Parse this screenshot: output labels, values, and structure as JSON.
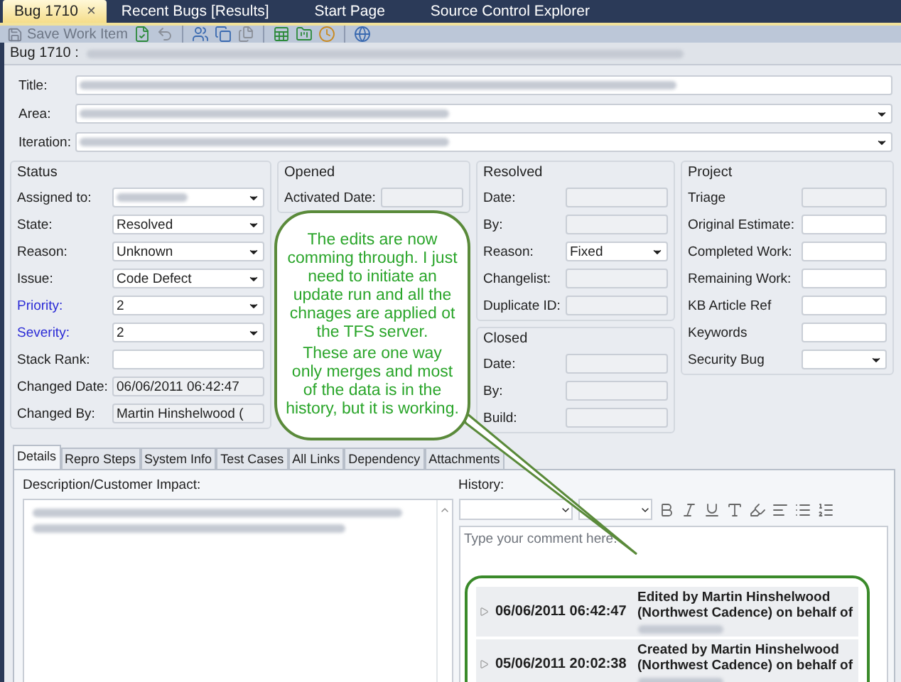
{
  "tabs": [
    {
      "label": "Bug 1710",
      "selected": true,
      "close": "×"
    },
    {
      "label": "Recent Bugs [Results]",
      "selected": false
    },
    {
      "label": "Start Page",
      "selected": false
    },
    {
      "label": "Source Control Explorer",
      "selected": false
    }
  ],
  "toolbar": {
    "save": {
      "label": "Save Work Item",
      "disabled": true
    }
  },
  "header": {
    "label": "Bug 1710 :"
  },
  "top_fields": [
    {
      "label": "Title:",
      "kind": "text"
    },
    {
      "label": "Area:",
      "kind": "dropdown"
    },
    {
      "label": "Iteration:",
      "kind": "dropdown"
    }
  ],
  "columns": [
    {
      "groups": [
        {
          "title": "Status",
          "fields": [
            {
              "label": "Assigned to:",
              "kind": "dropdown",
              "redacted": true,
              "required": false
            },
            {
              "label": "State:",
              "kind": "dropdown",
              "value": "Resolved",
              "required": false
            },
            {
              "label": "Reason:",
              "kind": "dropdown",
              "value": "Unknown",
              "required": false
            },
            {
              "label": "Issue:",
              "kind": "dropdown",
              "value": "Code Defect",
              "required": false
            },
            {
              "label": "Priority:",
              "kind": "dropdown",
              "value": "2",
              "required": true
            },
            {
              "label": "Severity:",
              "kind": "dropdown",
              "value": "2",
              "required": true
            },
            {
              "label": "Stack Rank:",
              "kind": "text",
              "required": false
            },
            {
              "label": "Changed Date:",
              "kind": "readonly",
              "value": "06/06/2011 06:42:47",
              "required": false
            },
            {
              "label": "Changed By:",
              "kind": "readonly",
              "value": "Martin Hinshelwood (",
              "required": false
            }
          ]
        }
      ]
    },
    {
      "groups": [
        {
          "title": "Opened",
          "fields": [
            {
              "label": "Activated Date:",
              "kind": "readonly"
            }
          ]
        }
      ]
    },
    {
      "groups": [
        {
          "title": "Resolved",
          "fields": [
            {
              "label": "Date:",
              "kind": "readonly"
            },
            {
              "label": "By:",
              "kind": "readonly"
            },
            {
              "label": "Reason:",
              "kind": "dropdown",
              "value": "Fixed"
            },
            {
              "label": "Changelist:",
              "kind": "readonly"
            },
            {
              "label": "Duplicate ID:",
              "kind": "readonly"
            }
          ]
        },
        {
          "title": "Closed",
          "fields": [
            {
              "label": "Date:",
              "kind": "readonly"
            },
            {
              "label": "By:",
              "kind": "readonly"
            },
            {
              "label": "Build:",
              "kind": "readonly"
            }
          ]
        }
      ]
    },
    {
      "groups": [
        {
          "title": "Project",
          "fields": [
            {
              "label": "Triage",
              "kind": "readonly"
            },
            {
              "label": "Original Estimate:",
              "kind": "text"
            },
            {
              "label": "Completed Work:",
              "kind": "text"
            },
            {
              "label": "Remaining Work:",
              "kind": "text"
            },
            {
              "label": "KB Article Ref",
              "kind": "text"
            },
            {
              "label": "Keywords",
              "kind": "text"
            },
            {
              "label": "Security Bug",
              "kind": "dropdown"
            }
          ]
        }
      ]
    }
  ],
  "detail_tabs": [
    {
      "label": "Details",
      "selected": true
    },
    {
      "label": "Repro Steps",
      "selected": false
    },
    {
      "label": "System Info",
      "selected": false
    },
    {
      "label": "Test Cases",
      "selected": false
    },
    {
      "label": "All Links",
      "selected": false
    },
    {
      "label": "Dependency",
      "selected": false
    },
    {
      "label": "Attachments",
      "selected": false
    }
  ],
  "description": {
    "label": "Description/Customer Impact:"
  },
  "history": {
    "label": "History:",
    "placeholder": "Type your comment here.",
    "entries": [
      {
        "date": "06/06/2011 06:42:47",
        "text": "Edited by Martin Hinshelwood (Northwest Cadence) on behalf of"
      },
      {
        "date": "05/06/2011 20:02:38",
        "text": "Created by Martin Hinshelwood (Northwest Cadence) on behalf of"
      }
    ]
  },
  "callout": {
    "paragraphs": [
      "The edits are now comming through. I just need to initiate an update run and all the chnages are applied ot the TFS server.",
      "These are one way only merges and most of the data is in the history, but it is working."
    ]
  }
}
